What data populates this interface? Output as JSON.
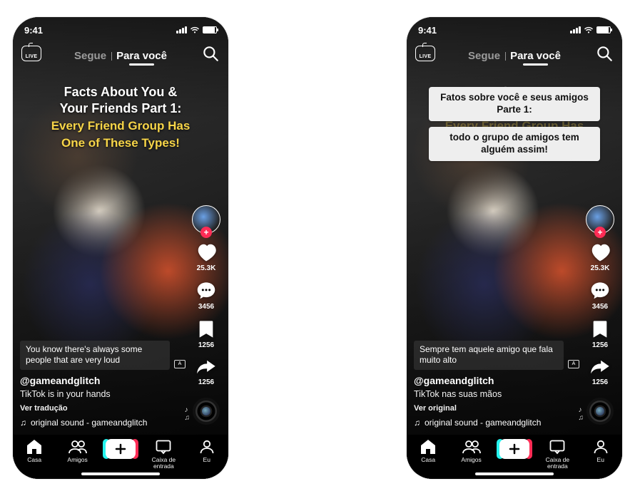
{
  "status": {
    "time": "9:41"
  },
  "topnav": {
    "live_label": "LIVE",
    "tab_following": "Segue",
    "tab_foryou": "Para você"
  },
  "overlay_title": {
    "line1": "Facts About You &",
    "line2": "Your Friends Part 1:",
    "sub1": "Every Friend Group Has",
    "sub2": "One of These Types!"
  },
  "translated_chips": {
    "chip1": "Fatos sobre você e seus amigos Parte 1:",
    "chip2": "todo o grupo de amigos tem alguém assim!"
  },
  "rail": {
    "like_count": "25.3K",
    "comment_count": "3456",
    "bookmark_count": "1256",
    "share_count": "1256"
  },
  "left_caption": {
    "subtitle": "You know there's always some people that are very loud",
    "handle": "@gameandglitch",
    "desc": "TikTok is in your hands",
    "translate_link": "Ver tradução",
    "music": "original sound - gameandglitch"
  },
  "right_caption": {
    "subtitle": "Sempre tem aquele amigo que fala muito alto",
    "handle": "@gameandglitch",
    "desc": "TikTok nas suas mãos",
    "translate_link": "Ver original",
    "music": "original sound - gameandglitch"
  },
  "tabbar": {
    "home": "Casa",
    "friends": "Amigos",
    "inbox": "Caixa de entrada",
    "me": "Eu"
  },
  "cc_label": "A",
  "music_note": "♫"
}
